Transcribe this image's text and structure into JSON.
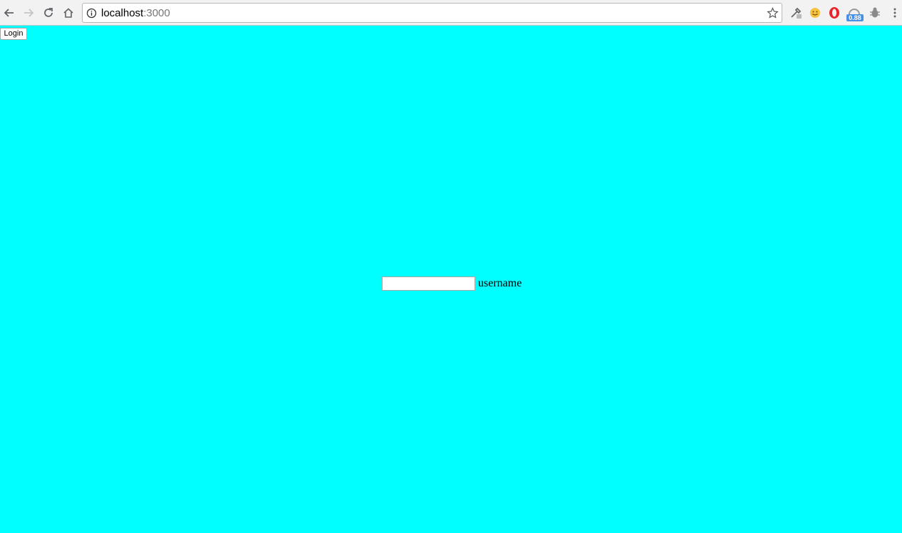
{
  "browser": {
    "url_host": "localhost",
    "url_port": ":3000",
    "extension_badge": "0.88",
    "icons": [
      "back-icon",
      "forward-icon",
      "reload-icon",
      "home-icon",
      "info-icon",
      "star-icon",
      "eyedropper-icon",
      "smiley-icon",
      "opera-icon",
      "speed-extension-icon",
      "bug-icon",
      "more-menu-icon"
    ]
  },
  "page": {
    "background_color": "#00ffff",
    "login_button_label": "Login",
    "username_value": "",
    "username_label": "username"
  }
}
